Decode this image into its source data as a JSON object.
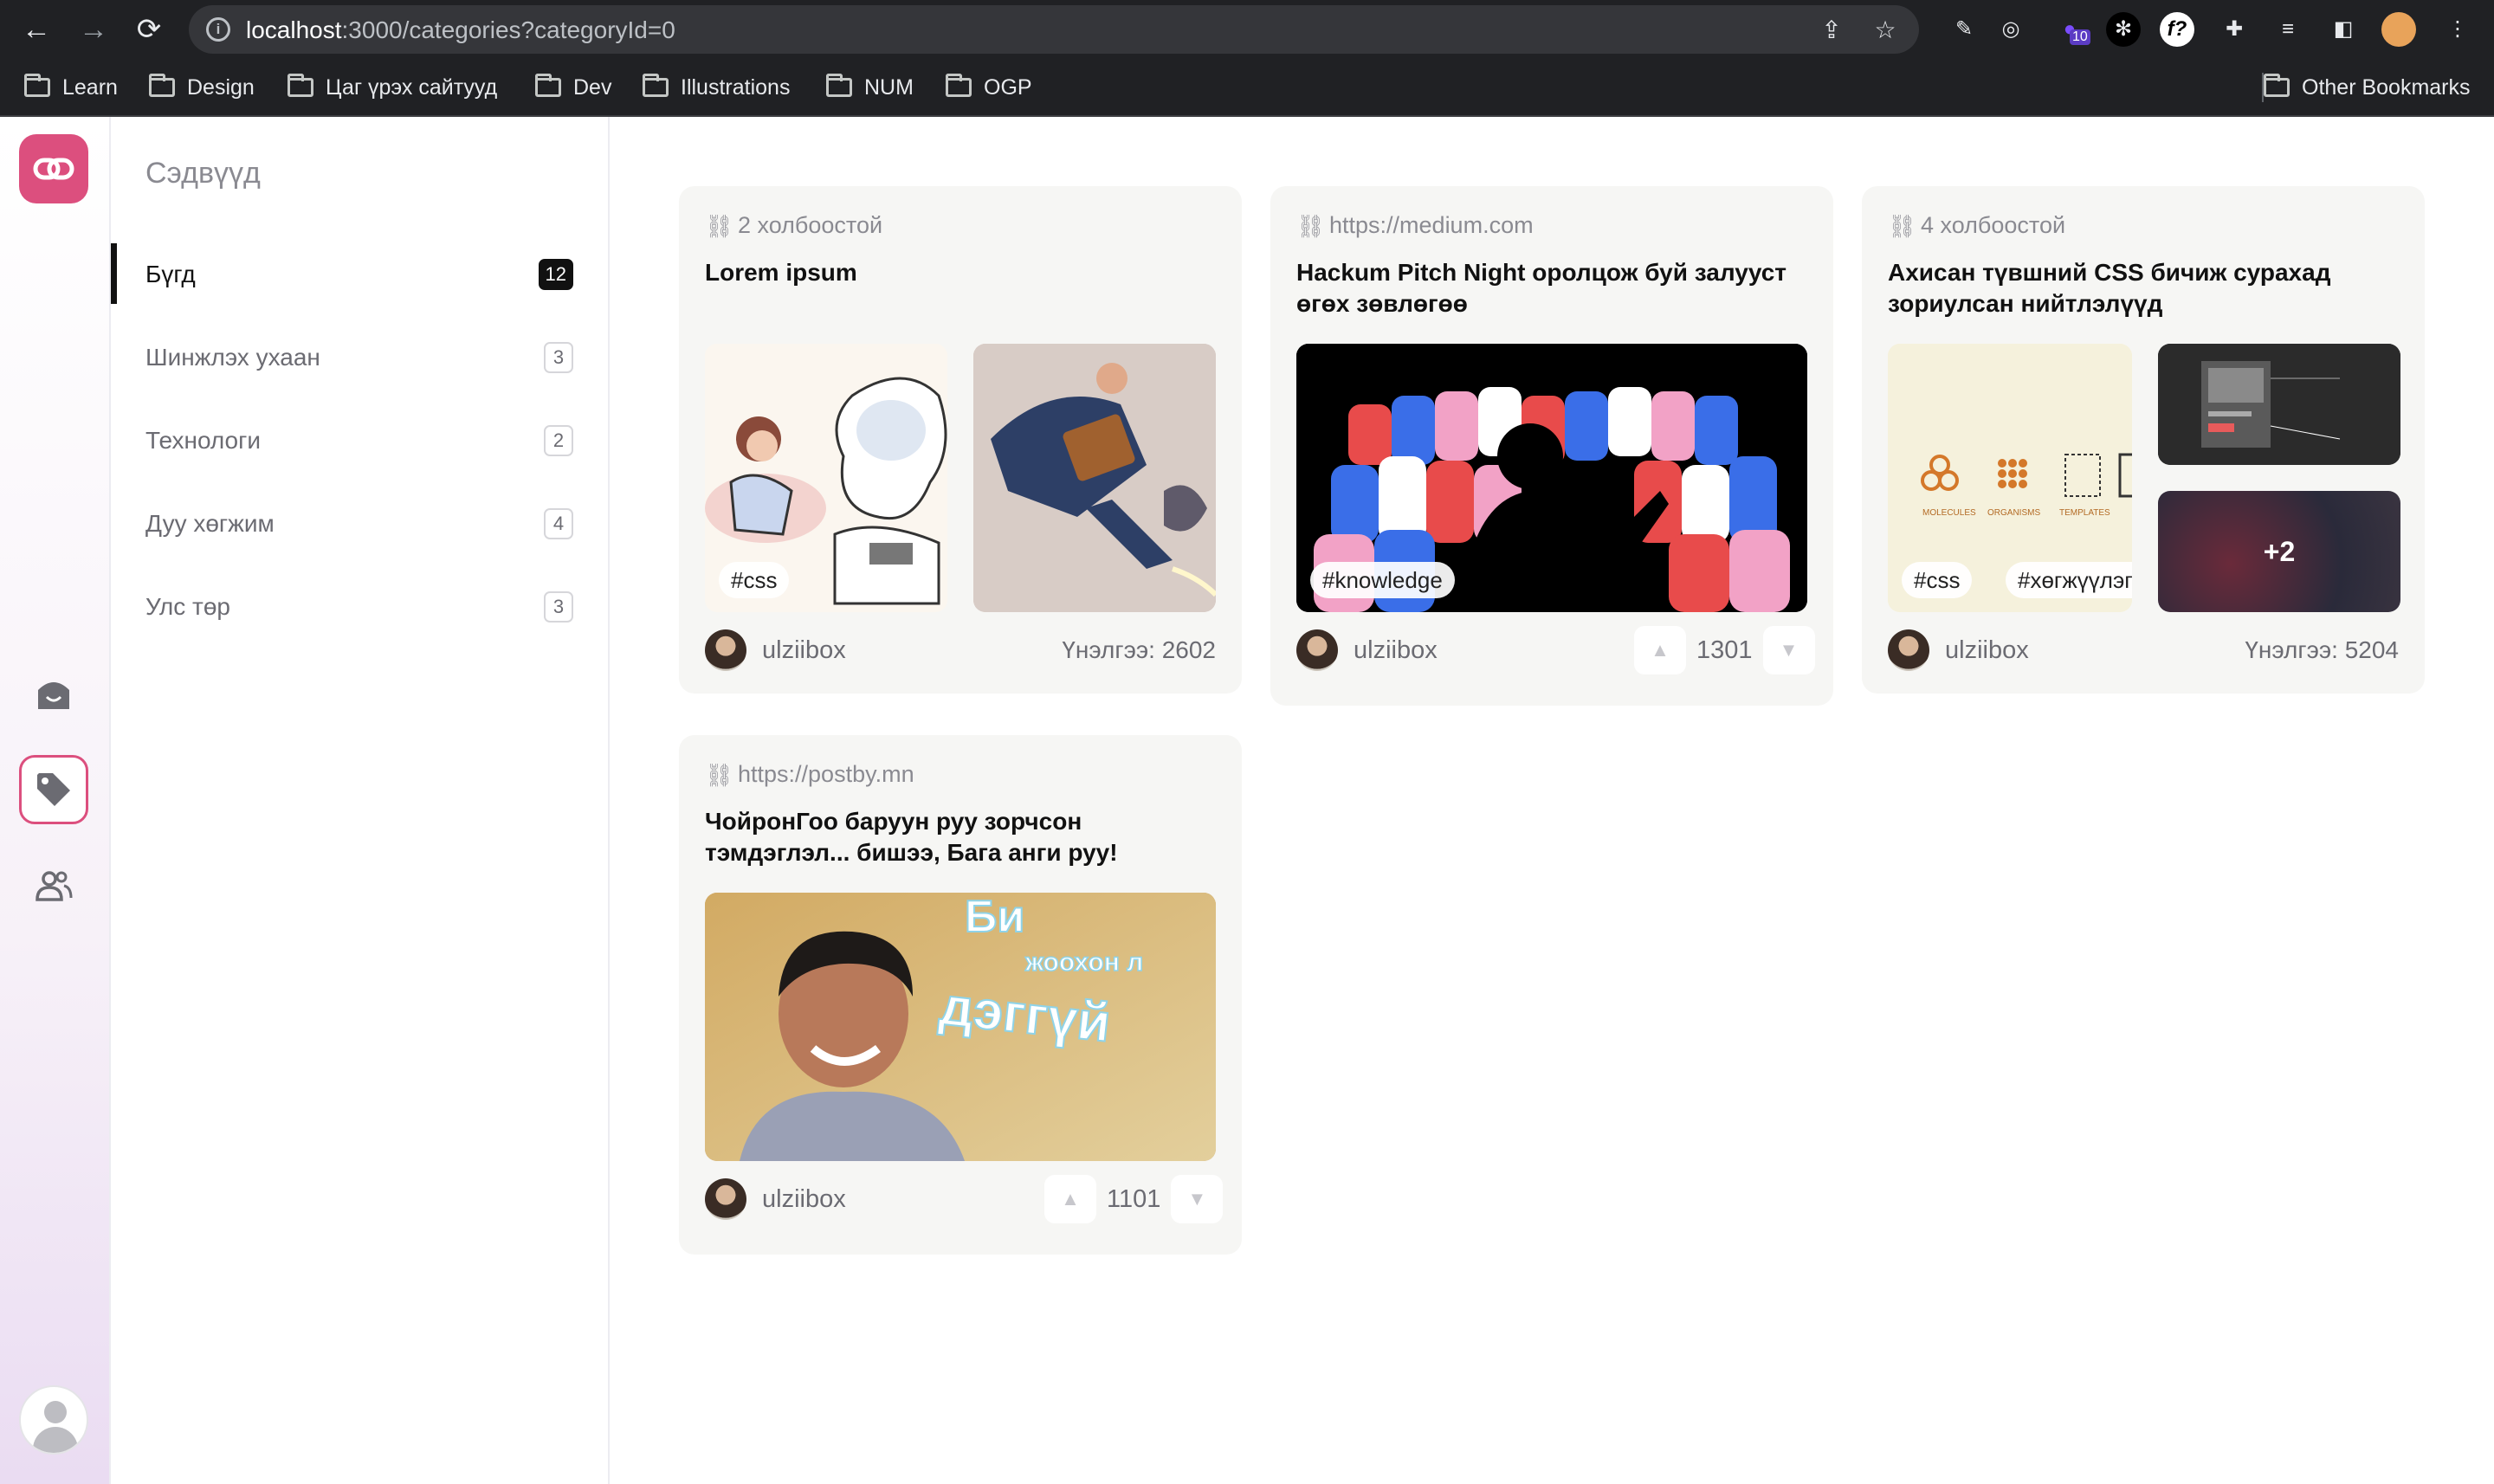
{
  "browser": {
    "url_host": "localhost",
    "url_rest": ":3000/categories?categoryId=0",
    "bookmarks": [
      "Learn",
      "Design",
      "Цаг үрэх сайтууд",
      "Dev",
      "Illustrations",
      "NUM",
      "OGP"
    ],
    "other_bookmarks": "Other Bookmarks",
    "ext_badge": "10"
  },
  "sidebar": {
    "title": "Сэдвүүд",
    "categories": [
      {
        "label": "Бүгд",
        "count": "12"
      },
      {
        "label": "Шинжлэх ухаан",
        "count": "3"
      },
      {
        "label": "Технологи",
        "count": "2"
      },
      {
        "label": "Дуу хөгжим",
        "count": "4"
      },
      {
        "label": "Улс төр",
        "count": "3"
      }
    ]
  },
  "cards": [
    {
      "source": "2 холбоостой",
      "title": "Lorem ipsum",
      "tags": [
        "#css"
      ],
      "author": "ulziibox",
      "views": "Үнэлгээ: 2602"
    },
    {
      "source": "https://medium.com",
      "title": "Hackum Pitch Night оролцож буй залууст өгөх зөвлөгөө",
      "tags": [
        "#knowledge"
      ],
      "author": "ulziibox",
      "votes": "1301"
    },
    {
      "source": "4 холбоостой",
      "title": "Ахисан түвшний CSS бичиж сурахад зориулсан нийтлэлүүд",
      "tags": [
        "#css",
        "#хөгжүүлэгч"
      ],
      "more": "+2",
      "author": "ulziibox",
      "views": "Үнэлгээ: 5204",
      "thumb_labels": [
        "MOLECULES",
        "ORGANISMS",
        "TEMPLATES"
      ]
    },
    {
      "source": "https://postby.mn",
      "title": "ЧойронГоо баруун руу зорчсон тэмдэглэл... бишээ, Бага анги руу!",
      "author": "ulziibox",
      "votes": "1101",
      "image_text": [
        "Би",
        "жоохон л",
        "дэггүй"
      ]
    }
  ],
  "colors": {
    "accent": "#dc4f7e",
    "card_bg": "#f6f6f4",
    "chrome": "#202124"
  }
}
